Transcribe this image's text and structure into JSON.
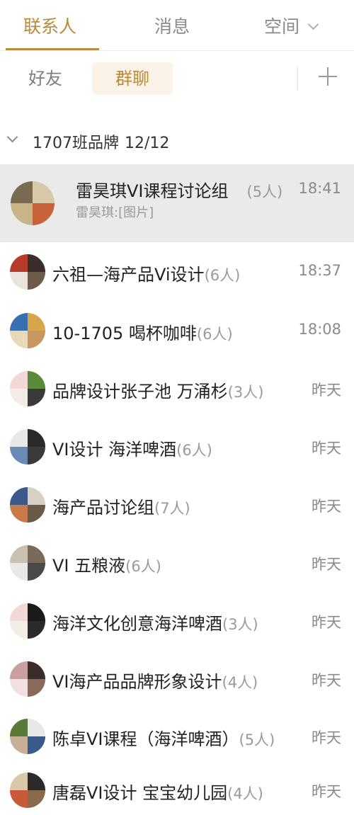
{
  "tabs": [
    {
      "label": "联系人",
      "active": true
    },
    {
      "label": "消息",
      "active": false
    },
    {
      "label": "空间",
      "active": false
    }
  ],
  "subtabs": [
    {
      "label": "好友",
      "active": false
    },
    {
      "label": "群聊",
      "active": true
    }
  ],
  "group": {
    "name": "1707班品牌",
    "count": "12/12"
  },
  "chats": [
    {
      "name": "雷昊琪VI课程讨论组",
      "members": "(5人)",
      "time": "18:41",
      "preview": "雷昊琪:[图片]",
      "selected": true,
      "avatar_colors": [
        "#7a6a52",
        "#d8c9a8",
        "#c9b48a",
        "#c8623a"
      ]
    },
    {
      "name": "六祖—海产品Vi设计",
      "members": "(6人)",
      "time": "18:37",
      "avatar_colors": [
        "#b83a2a",
        "#3a2e2a",
        "#e9e4dc",
        "#6d5c4c"
      ]
    },
    {
      "name": "10-1705  喝杯咖啡",
      "members": "(6人)",
      "time": "18:08",
      "avatar_colors": [
        "#3a6fb3",
        "#d8a64a",
        "#e8d9b8",
        "#c99560"
      ]
    },
    {
      "name": "品牌设计张子池 万涌杉",
      "members": "(3人)",
      "time": "昨天",
      "avatar_colors": [
        "#f2d8d6",
        "#5a8a3a",
        "#f2ece4",
        "#3a3a3a"
      ]
    },
    {
      "name": "VI设计 海洋啤酒",
      "members": "(6人)",
      "time": "昨天",
      "avatar_colors": [
        "#e8e8e8",
        "#2a2a2a",
        "#6a8ab8",
        "#3a3a3a"
      ]
    },
    {
      "name": "海产品讨论组",
      "members": "(7人)",
      "time": "昨天",
      "avatar_colors": [
        "#3a5a8a",
        "#d8d0c4",
        "#c87a4a",
        "#6a5a4a"
      ]
    },
    {
      "name": "VI 五粮液",
      "members": "(6人)",
      "time": "昨天",
      "avatar_colors": [
        "#c8c0b4",
        "#7a6a5a",
        "#e8e8e8",
        "#4a4a4a"
      ]
    },
    {
      "name": "海洋文化创意海洋啤酒",
      "members": "(3人)",
      "time": "昨天",
      "avatar_colors": [
        "#f2d8d6",
        "#1a1a1a",
        "#f2ece4",
        "#2a2a2a"
      ]
    },
    {
      "name": "VI海产品品牌形象设计",
      "members": "(4人)",
      "time": "昨天",
      "avatar_colors": [
        "#c8a0a0",
        "#3a2e2a",
        "#f0e0e0",
        "#8a6a5a"
      ]
    },
    {
      "name": "陈卓VI课程（海洋啤酒）",
      "members": "(5人)",
      "time": "昨天",
      "avatar_colors": [
        "#5a7a3a",
        "#e8e8e8",
        "#c8b098",
        "#3a5a8a"
      ]
    },
    {
      "name": "唐磊VI设计 宝宝幼儿园",
      "members": "(4人)",
      "time": "昨天",
      "avatar_colors": [
        "#d8c8a8",
        "#2a2a2a",
        "#c85a3a",
        "#8a6a4a"
      ]
    }
  ],
  "colors": {
    "accent": "#b88a3b",
    "selected_bg": "#eaeaea",
    "subtab_active_bg": "#fbf3e7"
  }
}
